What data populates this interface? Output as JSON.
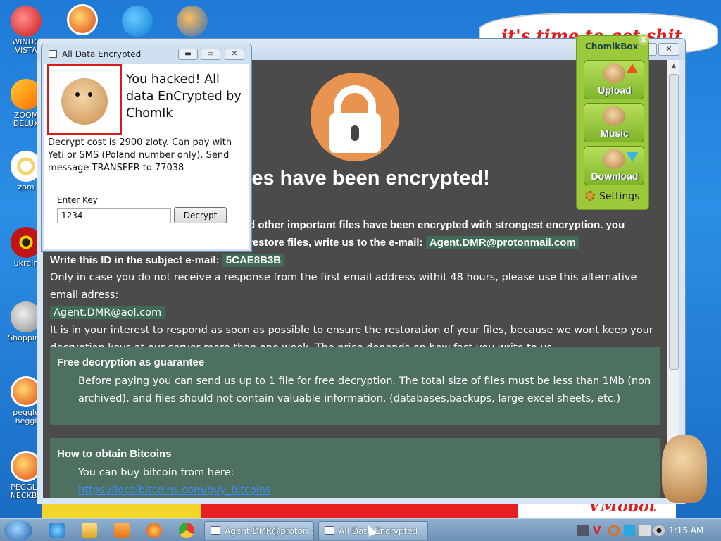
{
  "desktop": {
    "wallpaper_top_text": "it's time to get shit",
    "wallpaper_bottom_text": "VMobot",
    "icons": [
      {
        "label": "WINDO VISTA",
        "icon": "red-orb-icon"
      },
      {
        "label": "ZOOM DELUX",
        "icon": "zoom-icon"
      },
      {
        "label": "zom",
        "icon": "flower-icon"
      },
      {
        "label": "ukrain",
        "icon": "radiation-icon"
      },
      {
        "label": "Shopping",
        "icon": "flash-icon"
      },
      {
        "label": "peggle heggl",
        "icon": "peggle-icon"
      },
      {
        "label": "PEGGLE NECKBE",
        "icon": "peggle-icon"
      }
    ]
  },
  "main_window": {
    "headline": "r files have been encrypted!",
    "line1_a": "d other important files have been encrypted with strongest encryption. you",
    "line2_a": "restore files, write us to the e-mail:",
    "email_primary": "Agent.DMR@protonmail.com",
    "id_label": "Write this ID in the subject e-mail:",
    "id_value": "5CAE8B3B",
    "alt_text": "Only in case you do not receive a response from the first email address withit 48 hours, please use this alternative email adress:",
    "email_alt": "Agent.DMR@aol.com",
    "interest_text": "It is in your interest to respond as soon as possible to ensure the restoration of your files, because we wont keep your decryption keys at our server more than one week. The price depends on how fast you write to us.",
    "guarantee_title": "Free decryption as guarantee",
    "guarantee_text": "Before paying you can send us up to 1 file for free decryption. The total size of files must be less than 1Mb (non archived), and files should not contain valuable information. (databases,backups, large excel sheets, etc.)",
    "bitcoin_title": "How to obtain Bitcoins",
    "bitcoin_text": "You can buy bitcoin from here:",
    "bitcoin_link": "https://localbitcoins.com/buy_bitcoins"
  },
  "small_window": {
    "title": "All Data Encrypted",
    "hacked_text": "You hacked! All data EnCrypted by ChomIk",
    "cost_text": "Decrypt cost is 2900 zloty. Can pay with Yeti or SMS (Poland number only). Send message TRANSFER to 77038",
    "key_label": "Enter Key",
    "key_value": "1234",
    "decrypt_label": "Decrypt"
  },
  "chomikbox": {
    "title": "ChomikBox",
    "buttons": [
      "Upload",
      "Music",
      "Download"
    ],
    "settings_label": "Settings"
  },
  "taskbar": {
    "tasks": [
      "Agent.DMR@proton...",
      "All Data Encrypted"
    ],
    "clock": "1:15 AM"
  }
}
